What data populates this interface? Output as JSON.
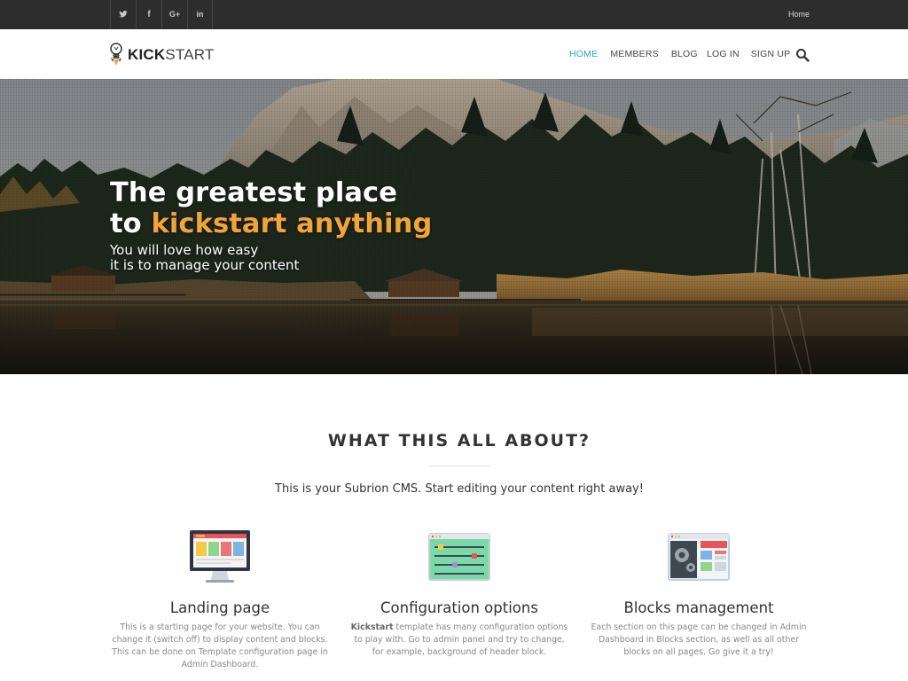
{
  "topbar": {
    "social": [
      {
        "name": "twitter-icon"
      },
      {
        "name": "facebook-icon",
        "glyph": "f"
      },
      {
        "name": "google-plus-icon",
        "glyph": "G+"
      },
      {
        "name": "linkedin-icon",
        "glyph": "in"
      }
    ],
    "home_link": "Home"
  },
  "header": {
    "logo_bold": "KICK",
    "logo_rest": "START",
    "nav_main": [
      {
        "label": "HOME",
        "active": true
      },
      {
        "label": "MEMBERS",
        "active": false
      },
      {
        "label": "BLOG",
        "active": false
      }
    ],
    "nav_auth": [
      {
        "label": "LOG IN"
      },
      {
        "label": "SIGN UP"
      }
    ],
    "search_icon": "search-icon"
  },
  "hero": {
    "title_line1": "The greatest place",
    "title_line2_prefix": "to ",
    "title_line2_accent": "kickstart anything",
    "subtitle_line1": "You will love how easy",
    "subtitle_line2": "it is to manage your content",
    "accent_color": "#f2a33a"
  },
  "about": {
    "title": "WHAT THIS ALL ABOUT?",
    "lead": "This is your Subrion CMS. Start editing your content right away!",
    "features": [
      {
        "icon": "monitor-icon",
        "title": "Landing page",
        "text": "This is a starting page for your website. You can change it (switch off) to display content and blocks. This can be done on Template configuration page in Admin Dashboard."
      },
      {
        "icon": "sliders-window-icon",
        "title": "Configuration options",
        "text_bold": "Kickstart",
        "text": " template has many configuration options to play with. Go to admin panel and try to change, for example, background of header block."
      },
      {
        "icon": "gear-window-icon",
        "title": "Blocks management",
        "text": "Each section on this page can be changed in Admin Dashboard in Blocks section, as well as all other blocks on all pages. Go give it a try!"
      }
    ]
  },
  "colors": {
    "topbar_bg": "#2d2d2d",
    "nav_active": "#2aa3d8",
    "accent": "#f2a33a"
  }
}
